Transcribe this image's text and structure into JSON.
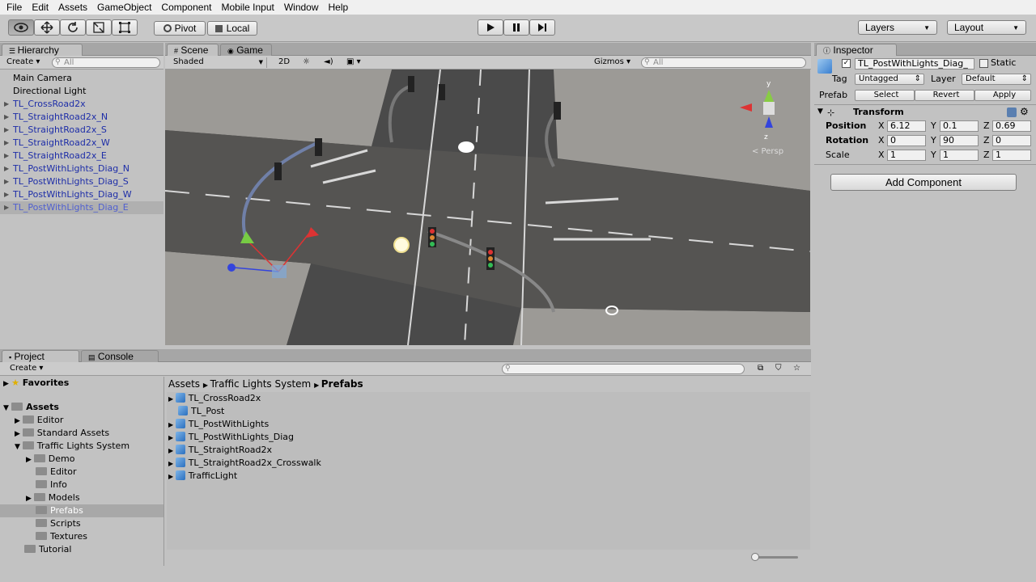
{
  "menu": [
    "File",
    "Edit",
    "Assets",
    "GameObject",
    "Component",
    "Mobile Input",
    "Window",
    "Help"
  ],
  "toolbar": {
    "pivot": "Pivot",
    "local": "Local",
    "layers": "Layers",
    "layout": "Layout"
  },
  "hierarchy": {
    "tab": "Hierarchy",
    "create": "Create",
    "search_placeholder": "All",
    "items": [
      {
        "label": "Main Camera",
        "prefab": false
      },
      {
        "label": "Directional Light",
        "prefab": false
      },
      {
        "label": "TL_CrossRoad2x",
        "prefab": true
      },
      {
        "label": "TL_StraightRoad2x_N",
        "prefab": true
      },
      {
        "label": "TL_StraightRoad2x_S",
        "prefab": true
      },
      {
        "label": "TL_StraightRoad2x_W",
        "prefab": true
      },
      {
        "label": "TL_StraightRoad2x_E",
        "prefab": true
      },
      {
        "label": "TL_PostWithLights_Diag_N",
        "prefab": true
      },
      {
        "label": "TL_PostWithLights_Diag_S",
        "prefab": true
      },
      {
        "label": "TL_PostWithLights_Diag_W",
        "prefab": true
      },
      {
        "label": "TL_PostWithLights_Diag_E",
        "prefab": true,
        "selected": true
      }
    ]
  },
  "scene": {
    "tab_scene": "Scene",
    "tab_game": "Game",
    "shading": "Shaded",
    "mode2d": "2D",
    "gizmos": "Gizmos",
    "search_placeholder": "All",
    "persp": "< Persp",
    "axis_y": "y",
    "axis_z": "z"
  },
  "inspector": {
    "tab": "Inspector",
    "object_name": "TL_PostWithLights_Diag_",
    "static": "Static",
    "tag_label": "Tag",
    "tag_value": "Untagged",
    "layer_label": "Layer",
    "layer_value": "Default",
    "prefab_label": "Prefab",
    "select": "Select",
    "revert": "Revert",
    "apply": "Apply",
    "transform": "Transform",
    "position_label": "Position",
    "rotation_label": "Rotation",
    "scale_label": "Scale",
    "x": "X",
    "y": "Y",
    "z": "Z",
    "position": {
      "x": "6.12",
      "y": "0.1",
      "z": "0.69"
    },
    "rotation": {
      "x": "0",
      "y": "90",
      "z": "0"
    },
    "scale": {
      "x": "1",
      "y": "1",
      "z": "1"
    },
    "add_component": "Add Component"
  },
  "project": {
    "tab_project": "Project",
    "tab_console": "Console",
    "create": "Create",
    "favorites": "Favorites",
    "assets": "Assets",
    "tree": {
      "editor": "Editor",
      "standard_assets": "Standard Assets",
      "traffic_lights_system": "Traffic Lights System",
      "demo": "Demo",
      "editor2": "Editor",
      "info": "Info",
      "models": "Models",
      "prefabs": "Prefabs",
      "scripts": "Scripts",
      "textures": "Textures",
      "tutorial": "Tutorial"
    },
    "breadcrumb": {
      "a": "Assets",
      "b": "Traffic Lights System",
      "c": "Prefabs"
    },
    "files": [
      "TL_CrossRoad2x",
      "TL_Post",
      "TL_PostWithLights",
      "TL_PostWithLights_Diag",
      "TL_StraightRoad2x",
      "TL_StraightRoad2x_Crosswalk",
      "TrafficLight"
    ]
  }
}
